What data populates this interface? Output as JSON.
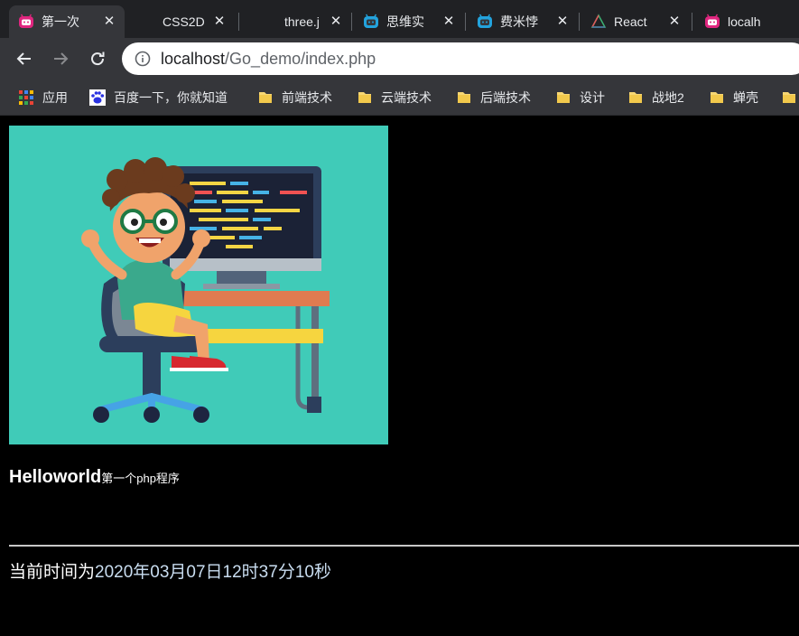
{
  "browser": {
    "tabs": [
      {
        "title": "第一次",
        "icon": "bilibili-icon",
        "active": true
      },
      {
        "title": "CSS2D",
        "icon": "blank-icon",
        "active": false
      },
      {
        "title": "three.j",
        "icon": "blank-icon",
        "active": false
      },
      {
        "title": "思维实",
        "icon": "bilibili-icon",
        "active": false
      },
      {
        "title": "费米悖",
        "icon": "bilibili-icon",
        "active": false
      },
      {
        "title": "React",
        "icon": "react-triangle-icon",
        "active": false
      },
      {
        "title": "localh",
        "icon": "bilibili-icon",
        "active": false
      }
    ],
    "address": {
      "host": "localhost",
      "path": "/Go_demo/index.php"
    },
    "bookmarks": [
      {
        "label": "应用",
        "icon": "apps-grid-icon"
      },
      {
        "label": "百度一下，你就知道",
        "icon": "baidu-paw-icon"
      },
      {
        "label": "前端技术",
        "icon": "folder-icon"
      },
      {
        "label": "云端技术",
        "icon": "folder-icon"
      },
      {
        "label": "后端技术",
        "icon": "folder-icon"
      },
      {
        "label": "设计",
        "icon": "folder-icon"
      },
      {
        "label": "战地2",
        "icon": "folder-icon"
      },
      {
        "label": "蝉壳",
        "icon": "folder-icon"
      }
    ]
  },
  "page": {
    "title_big": "Helloworld",
    "title_small": "第一个php程序",
    "time_prefix": "当前时间为",
    "time_value": "2020年03月07日12时37分10秒"
  },
  "colors": {
    "tab_strip": "#202124",
    "toolbar": "#35363a",
    "hero_bg": "#40cbb8",
    "bilibili_pink": "#e0267f",
    "bilibili_blue": "#23a3dd"
  }
}
